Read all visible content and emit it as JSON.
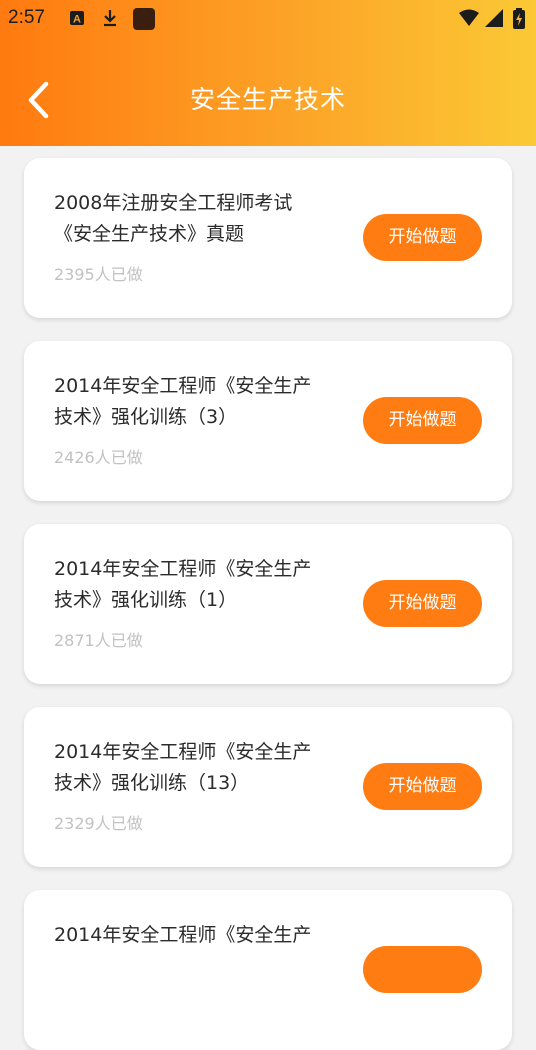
{
  "status_bar": {
    "time": "2:57",
    "icons": [
      "a-notification-icon",
      "download-icon",
      "app-notification-icon",
      "wifi-icon",
      "signal-icon",
      "battery-icon"
    ]
  },
  "header": {
    "title": "安全生产技术",
    "back_icon": "chevron-left-icon",
    "gradient": [
      "#ff7a10",
      "#fbc935"
    ]
  },
  "colors": {
    "accent": "#ff7c12",
    "count_text": "#c2c2c2"
  },
  "cards": [
    {
      "title_line1": "2008年注册安全工程师考试",
      "title_line2": "《安全生产技术》真题",
      "count": "2395人已做",
      "button": "开始做题"
    },
    {
      "title_line1": "2014年安全工程师《安全生产",
      "title_line2": "技术》强化训练（3）",
      "count": "2426人已做",
      "button": "开始做题"
    },
    {
      "title_line1": "2014年安全工程师《安全生产",
      "title_line2": "技术》强化训练（1）",
      "count": "2871人已做",
      "button": "开始做题"
    },
    {
      "title_line1": "2014年安全工程师《安全生产",
      "title_line2": "技术》强化训练（13）",
      "count": "2329人已做",
      "button": "开始做题"
    },
    {
      "title_line1": "2014年安全工程师《安全生产",
      "title_line2": "",
      "count": "",
      "button": ""
    }
  ]
}
